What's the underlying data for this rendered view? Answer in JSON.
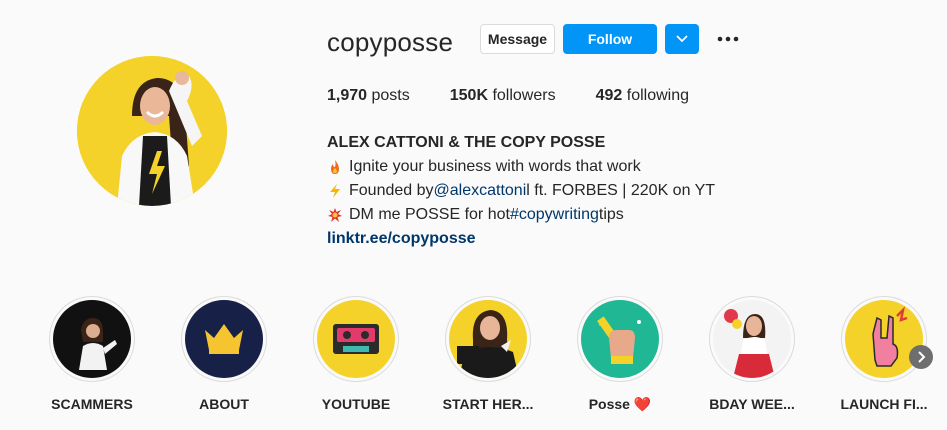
{
  "profile": {
    "username": "copyposse",
    "message_label": "Message",
    "follow_label": "Follow"
  },
  "stats": {
    "posts_count": "1,970",
    "posts_label": "posts",
    "followers_count": "150K",
    "followers_label": "followers",
    "following_count": "492",
    "following_label": "following"
  },
  "bio": {
    "name": "ALEX CATTONI & THE COPY POSSE",
    "line1": "Ignite your business with words that work",
    "line2_prefix": "Founded by ",
    "line2_mention": "@alexcattoni",
    "line2_suffix": " l ft. FORBES | 220K on YT",
    "line3_prefix": "DM me POSSE for hot ",
    "line3_hashtag": "#copywriting",
    "line3_suffix": " tips",
    "link": "linktr.ee/copyposse"
  },
  "highlights": [
    {
      "label": "SCAMMERS",
      "icon": "person-photo"
    },
    {
      "label": "ABOUT",
      "icon": "crown-icon"
    },
    {
      "label": "YOUTUBE",
      "icon": "cassette-icon"
    },
    {
      "label": "START HER...",
      "icon": "person-photo"
    },
    {
      "label": "Posse ❤️",
      "icon": "fist-pencil-icon"
    },
    {
      "label": "BDAY WEE...",
      "icon": "person-photo"
    },
    {
      "label": "LAUNCH FI...",
      "icon": "rock-hand-icon"
    }
  ],
  "colors": {
    "accent": "#0095f6",
    "avatar_bg": "#f4d22a",
    "link": "#00376b"
  }
}
